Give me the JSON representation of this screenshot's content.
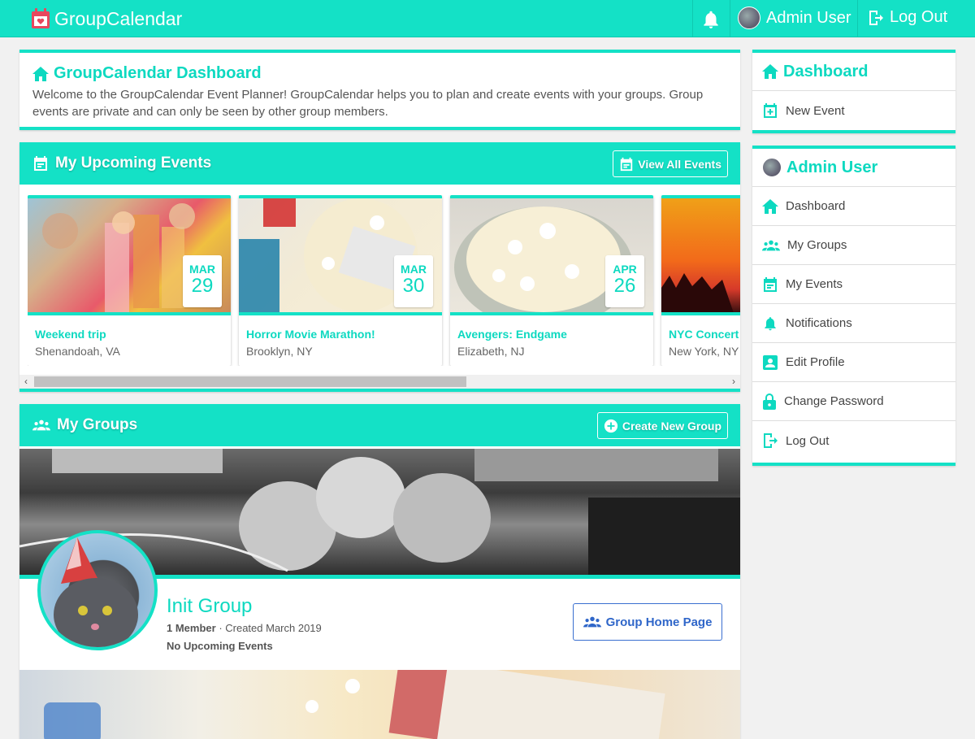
{
  "app": {
    "brand": "GroupCalendar",
    "accent_color": "#14e1c6",
    "link_color": "#2f66c9"
  },
  "topnav": {
    "notifications_icon": "bell-icon",
    "user_name": "Admin User",
    "logout_label": "Log Out"
  },
  "dashboard": {
    "title": "GroupCalendar Dashboard",
    "text": "Welcome to the GroupCalendar Event Planner! GroupCalendar helps you to plan and create events with your groups. Group events are private and can only be seen by other group members."
  },
  "events": {
    "title": "My Upcoming Events",
    "view_all_label": "View All Events",
    "items": [
      {
        "month": "MAR",
        "day": "29",
        "title": "Weekend trip",
        "location": "Shenandoah, VA"
      },
      {
        "month": "MAR",
        "day": "30",
        "title": "Horror Movie Marathon!",
        "location": "Brooklyn, NY"
      },
      {
        "month": "APR",
        "day": "26",
        "title": "Avengers: Endgame",
        "location": "Elizabeth, NJ"
      },
      {
        "month": "",
        "day": "",
        "title": "NYC Concert",
        "location": "New York, NY"
      }
    ]
  },
  "groups": {
    "title": "My Groups",
    "create_label": "Create New Group",
    "items": [
      {
        "name": "Init Group",
        "members": "1 Member",
        "created": " · Created March 2019",
        "upcoming": "No Upcoming Events",
        "home_label": "Group Home Page"
      }
    ]
  },
  "sidebar": {
    "dashboard_card": {
      "title": "Dashboard",
      "items": [
        {
          "label": "New Event",
          "icon": "plus-box-icon"
        }
      ]
    },
    "user_card": {
      "title": "Admin User",
      "items": [
        {
          "label": "Dashboard",
          "icon": "home-icon"
        },
        {
          "label": "My Groups",
          "icon": "groups-icon"
        },
        {
          "label": "My Events",
          "icon": "calendar-icon"
        },
        {
          "label": "Notifications",
          "icon": "bell-icon"
        },
        {
          "label": "Edit Profile",
          "icon": "profile-card-icon"
        },
        {
          "label": "Change Password",
          "icon": "lock-icon"
        },
        {
          "label": "Log Out",
          "icon": "logout-icon"
        }
      ]
    }
  }
}
